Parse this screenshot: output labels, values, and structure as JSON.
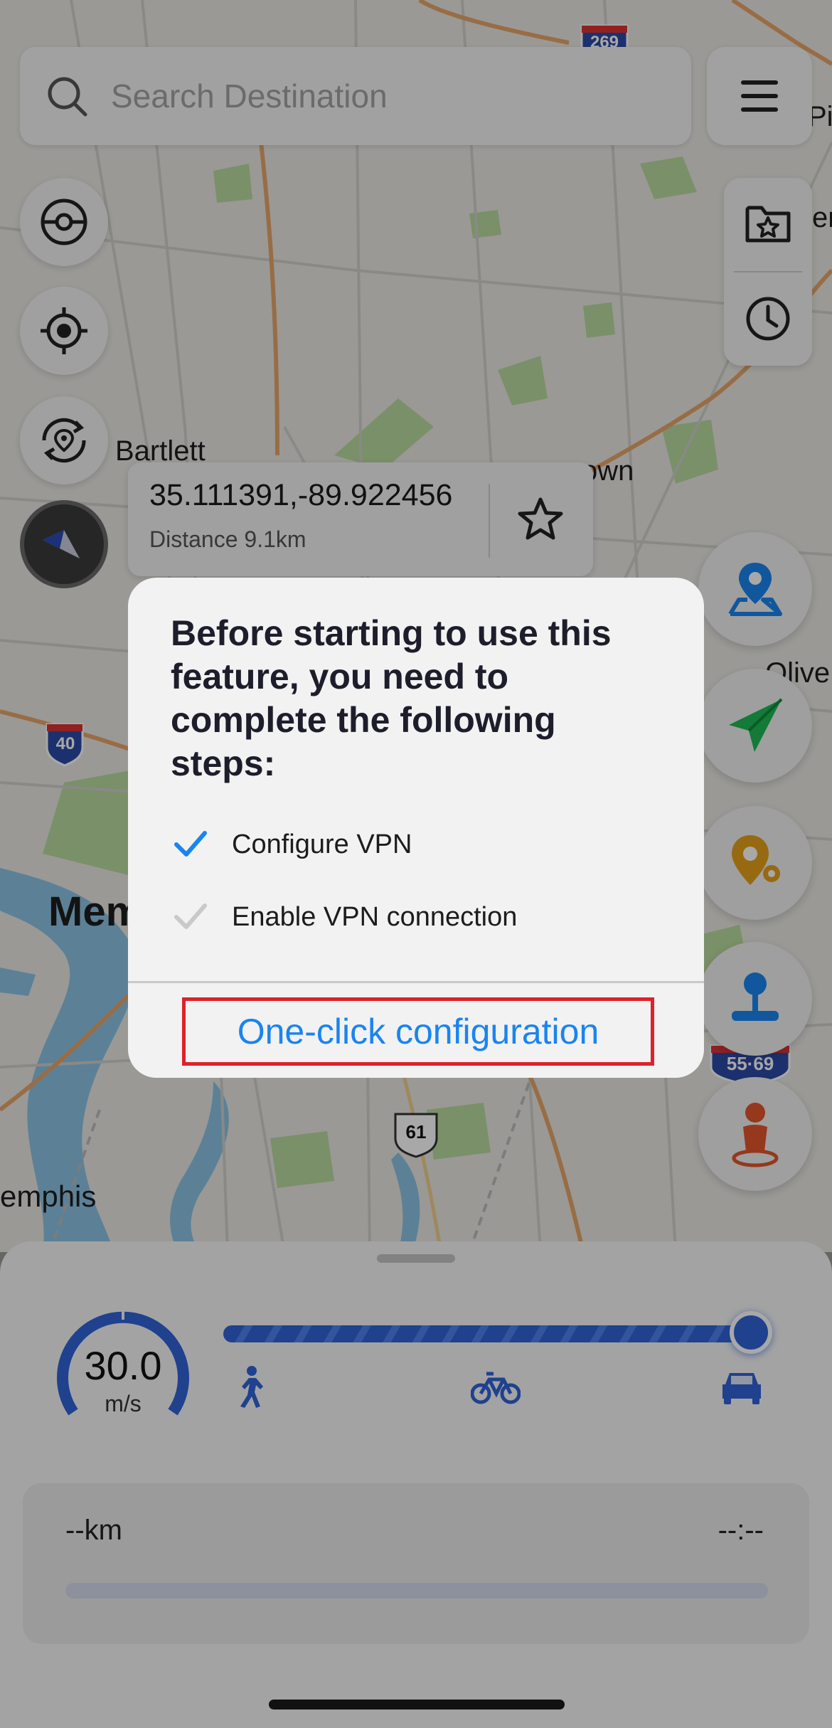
{
  "search": {
    "placeholder": "Search Destination"
  },
  "map": {
    "labels": {
      "bartlett": "Bartlett",
      "town": "own",
      "olive": "Olive",
      "memphis_big": "Mem",
      "memphis_small": "emphis",
      "pip": "Pip",
      "en": "en",
      "i40": "40",
      "i269": "269",
      "us61": "61",
      "i5569": "55·69"
    }
  },
  "location_card": {
    "coordinates": "35.111391,-89.922456",
    "distance": "Distance 9.1km"
  },
  "dialog": {
    "title": "Before starting to use this feature, you need to complete the following steps:",
    "steps": [
      {
        "label": "Configure VPN",
        "done": true
      },
      {
        "label": "Enable VPN connection",
        "done": false
      }
    ],
    "action_label": "One-click configuration"
  },
  "speed": {
    "value": "30.0",
    "unit": "m/s",
    "slider_fraction": 1.0
  },
  "route": {
    "distance": "--km",
    "time": "--:--",
    "progress_fraction": 0
  },
  "colors": {
    "accent_blue": "#1a84f0",
    "highlight_red": "#e0202a",
    "send_green": "#1db954",
    "pin_yellow": "#e6a21c",
    "person_orange": "#e2552b"
  }
}
